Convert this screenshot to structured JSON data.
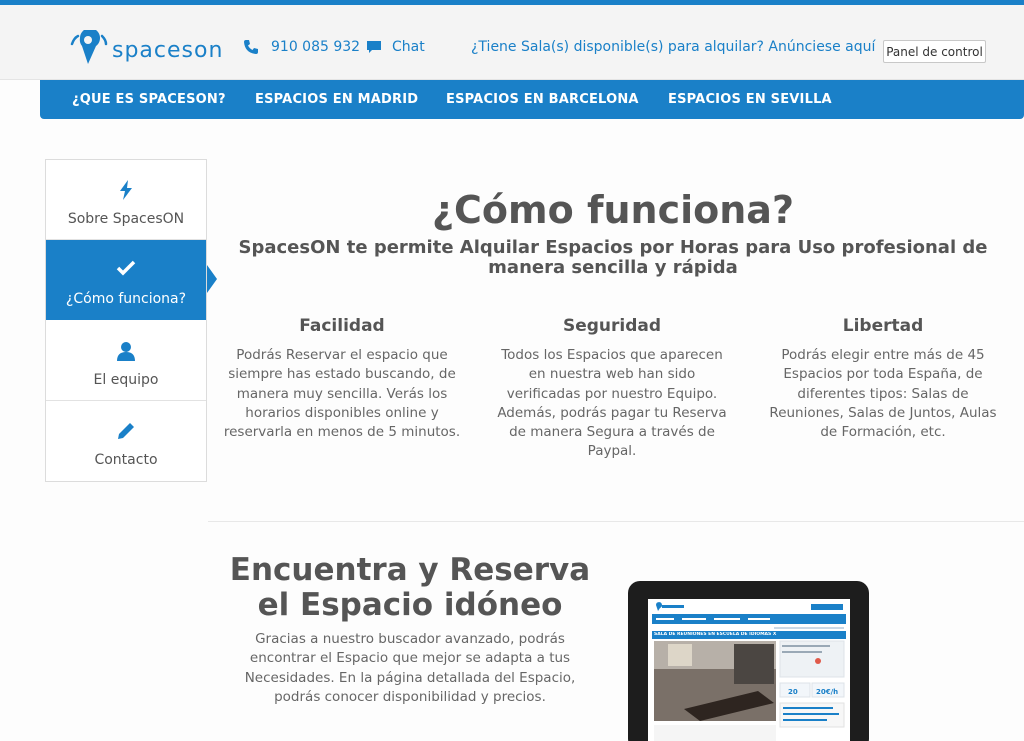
{
  "header": {
    "logo_text": "spaceson",
    "phone": "910 085 932",
    "chat": "Chat",
    "advert": "¿Tiene Sala(s) disponible(s) para alquilar? Anúnciese aquí",
    "panel_button": "Panel de control"
  },
  "nav": {
    "items": [
      {
        "label": "¿QUE ES SPACESON?"
      },
      {
        "label": "ESPACIOS EN MADRID"
      },
      {
        "label": "ESPACIOS EN BARCELONA"
      },
      {
        "label": "ESPACIOS EN SEVILLA"
      }
    ]
  },
  "sidebar": {
    "items": [
      {
        "label": "Sobre SpacesON",
        "icon": "bolt-icon",
        "active": false
      },
      {
        "label": "¿Cómo funciona?",
        "icon": "check-icon",
        "active": true
      },
      {
        "label": "El equipo",
        "icon": "user-icon",
        "active": false
      },
      {
        "label": "Contacto",
        "icon": "pencil-icon",
        "active": false
      }
    ]
  },
  "main": {
    "title": "¿Cómo funciona?",
    "subtitle_line1": "SpacesON te permite Alquilar Espacios por Horas para Uso profesional de",
    "subtitle_line2": "manera sencilla y rápida",
    "features": [
      {
        "title": "Facilidad",
        "lines": [
          "Podrás Reservar el espacio que",
          "siempre has estado buscando, de",
          "manera muy sencilla. Verás los",
          "horarios disponibles online y",
          "reservarla en menos de 5 minutos."
        ]
      },
      {
        "title": "Seguridad",
        "lines": [
          "Todos los Espacios que aparecen",
          "en nuestra web han sido",
          "verificadas por nuestro Equipo.",
          "Además, podrás pagar tu Reserva",
          "de manera Segura a través de",
          "Paypal."
        ]
      },
      {
        "title": "Libertad",
        "lines": [
          "Podrás elegir entre más de 45",
          "Espacios por toda España, de",
          "diferentes tipos: Salas de",
          "Reuniones, Salas de Juntos, Aulas",
          "de Formación, etc."
        ]
      }
    ],
    "section2": {
      "title_line1": "Encuentra y Reserva",
      "title_line2": "el Espacio idóneo",
      "lines": [
        "Gracias a nuestro buscador avanzado, podrás",
        "encontrar el Espacio que mejor se adapta a tus",
        "Necesidades. En la página detallada del Espacio,",
        "podrás conocer disponibilidad y precios."
      ]
    },
    "tablet": {
      "listing_title": "SALA DE REUNIONES EN ESCUELA DE IDIOMAS X",
      "capacity": "20",
      "price": "20€/h"
    }
  },
  "colors": {
    "brand": "#1a80c8",
    "text": "#555555"
  }
}
